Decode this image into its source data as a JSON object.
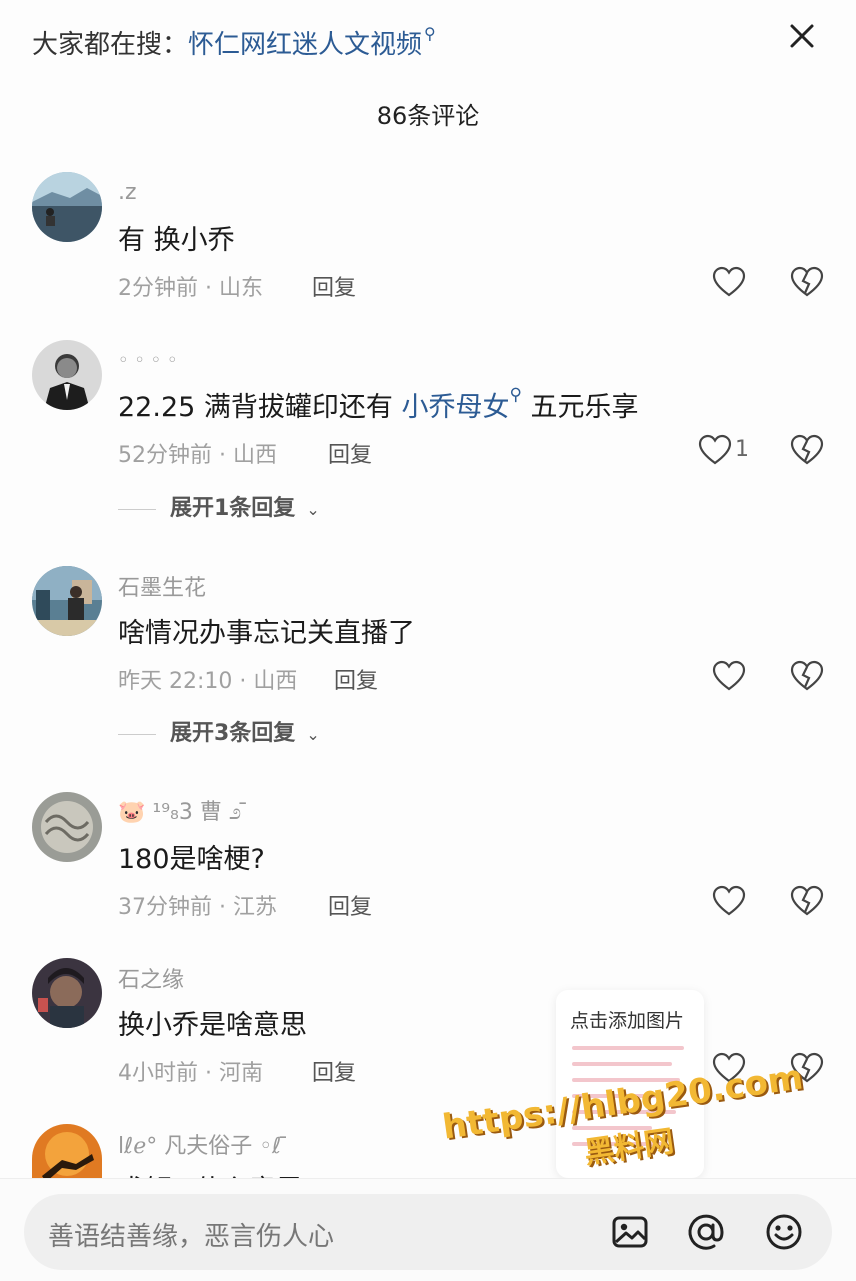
{
  "header": {
    "search_prefix": "大家都在搜：",
    "search_link": "怀仁网红迷人文视频",
    "comment_count_label": "86条评论"
  },
  "comments": [
    {
      "username": ".z",
      "text": "有  换小乔",
      "meta": "2分钟前 · 山东",
      "reply": "回复"
    },
    {
      "username": "◦ ◦ ◦ ◦",
      "text_before": "22.25  满背拔罐印还有 ",
      "text_link": "小乔母女",
      "text_after": "  五元乐享",
      "meta": "52分钟前 · 山西",
      "reply": "回复",
      "likes": "1",
      "expand": "展开1条回复"
    },
    {
      "username": "石墨生花",
      "text": "啥情况办事忘记关直播了",
      "meta": "昨天 22:10 · 山西",
      "reply": "回复",
      "expand": "展开3条回复"
    },
    {
      "username": "🐷 ¹⁹₈3 曹 ೨ ̄",
      "text": "180是啥梗?",
      "meta": "37分钟前 · 江苏",
      "reply": "回复"
    },
    {
      "username": "石之缘",
      "text": "换小乔是啥意思",
      "meta": "4小时前 · 河南",
      "reply": "回复"
    },
    {
      "username": "lℓℯ° 凡夫俗子 ◦ℓ ̄",
      "text": "求解? 什么意思"
    }
  ],
  "composer": {
    "placeholder": "善语结善缘，恶言伤人心"
  },
  "popup": {
    "title": "点击添加图片"
  },
  "watermark": {
    "url": "https://hlbg20.com",
    "name": "黑料网"
  },
  "icons": {
    "close": "close-icon",
    "search": "search-icon",
    "like": "heart-icon",
    "dislike": "broken-heart-icon",
    "image": "image-icon",
    "mention": "at-icon",
    "emoji": "emoji-icon",
    "chevron": "chevron-down-icon"
  }
}
